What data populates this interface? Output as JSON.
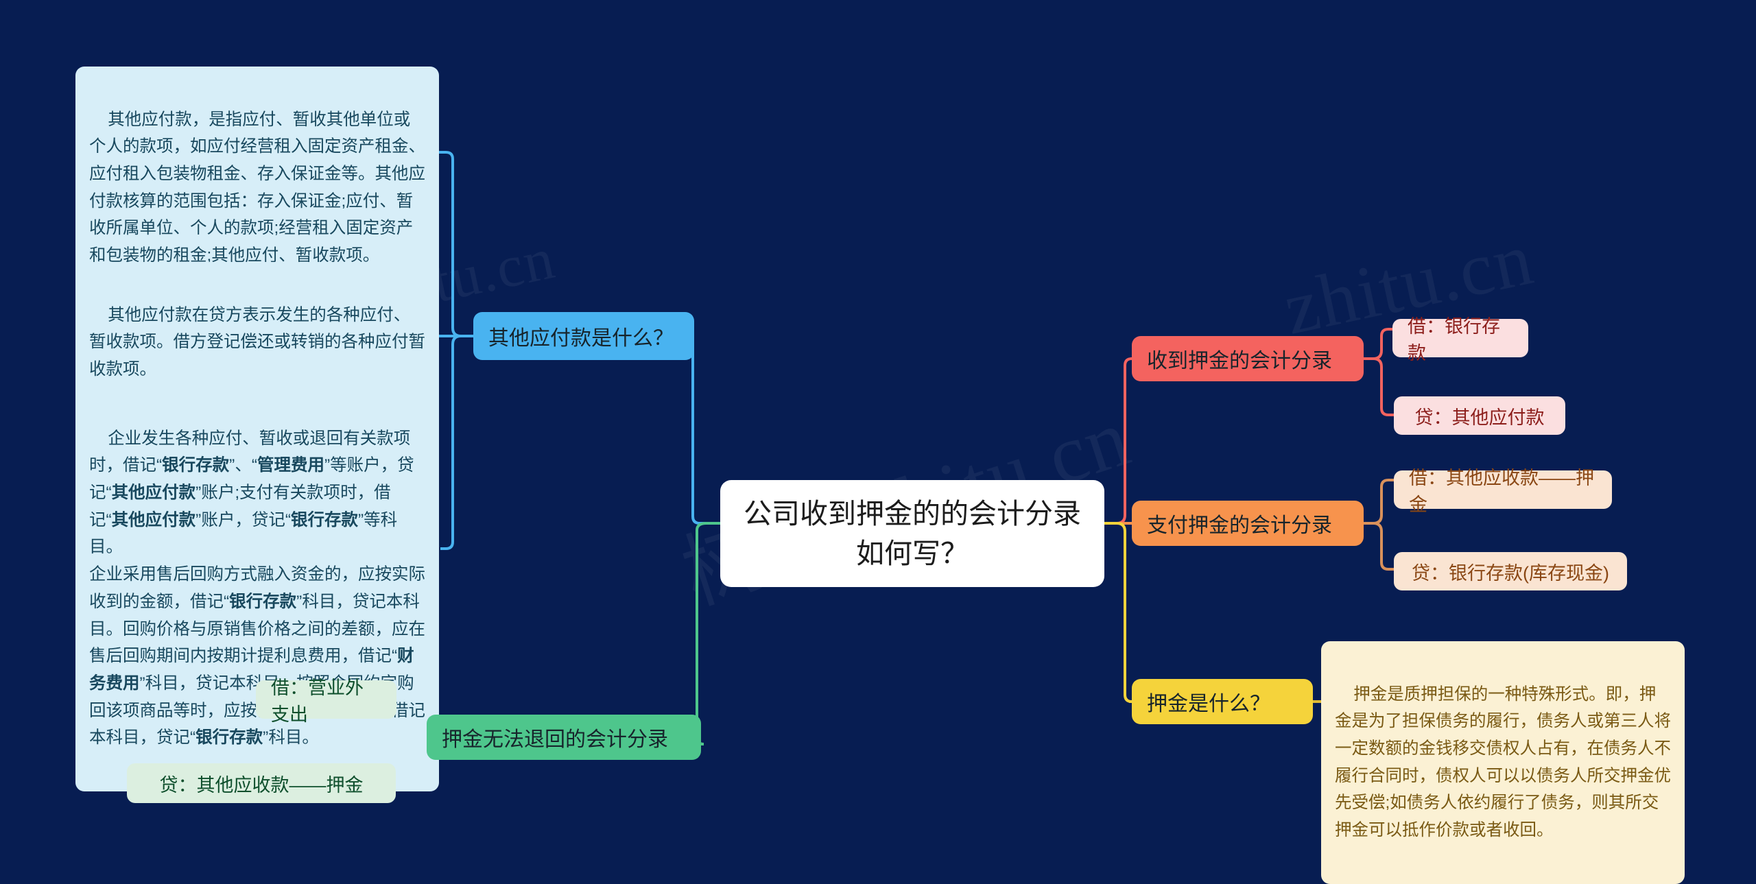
{
  "diagram": {
    "type": "mindmap",
    "background_color": "#071d52",
    "watermarks": [
      "zhitu.cn",
      "zhitu.cn",
      "树图 zhitu.cn"
    ],
    "root": {
      "label": "公司收到押金的的会计分录如何写？",
      "background": "#ffffff",
      "text_color": "#1c1c1c"
    },
    "branches": [
      {
        "id": "other-payables",
        "label": "其他应付款是什么？",
        "color": "#49b3f0",
        "side": "left",
        "children": [
          {
            "id": "op-def",
            "label": "其他应付款，是指应付、暂收其他单位或个人的款项，如应付经营租入固定资产租金、应付租入包装物租金、存入保证金等。其他应付款核算的范围包括：存入保证金;应付、暂收所属单位、个人的款项;经营租入固定资产和包装物的租金;其他应付、暂收款项。",
            "background": "#d7eef8",
            "text_color": "#18485e"
          },
          {
            "id": "op-direction",
            "label": "其他应付款在贷方表示发生的各种应付、暂收款项。借方登记偿还或转销的各种应付暂收款项。",
            "background": "#d7eef8",
            "text_color": "#18485e"
          },
          {
            "id": "op-entries",
            "label_html": "企业发生各种应付、暂收或退回有关款项时，借记“<b>银行存款</b>”、“<b>管理费用</b>”等账户，贷记“<b>其他应付款</b>”账户;支付有关款项时，借记“<b>其他应付款</b>”账户，贷记“<b>银行存款</b>”等科目。\n企业采用售后回购方式融入资金的，应按实际收到的金额，借记“<b>银行存款</b>”科目，贷记本科目。回购价格与原销售价格之间的差额，应在售后回购期间内按期计提利息费用，借记“<b>财务费用</b>”科目，贷记本科目。按照合同约定购回该项商品等时，应按实际支付的金额，借记本科目，贷记“<b>银行存款</b>”科目。",
            "background": "#d7eef8",
            "text_color": "#18485e"
          }
        ]
      },
      {
        "id": "non-refundable",
        "label": "押金无法退回的会计分录",
        "color": "#4ec68c",
        "side": "left",
        "children": [
          {
            "id": "nr-debit",
            "label": "借：营业外支出",
            "background": "#dcefe0",
            "text_color": "#0e4f2c"
          },
          {
            "id": "nr-credit",
            "label": "贷：其他应收款——押金",
            "background": "#dcefe0",
            "text_color": "#0e4f2c"
          }
        ]
      },
      {
        "id": "receive-deposit",
        "label": "收到押金的会计分录",
        "color": "#f4635f",
        "side": "right",
        "children": [
          {
            "id": "rd-debit",
            "label": "借：银行存款",
            "background": "#fbdfe0",
            "text_color": "#8d1f1c"
          },
          {
            "id": "rd-credit",
            "label": "贷：其他应付款",
            "background": "#fbdfe0",
            "text_color": "#8d1f1c"
          }
        ]
      },
      {
        "id": "pay-deposit",
        "label": "支付押金的会计分录",
        "color": "#f7934d",
        "side": "right",
        "children": [
          {
            "id": "pd-debit",
            "label": "借：其他应收款——押金",
            "background": "#fae4d2",
            "text_color": "#8a4714"
          },
          {
            "id": "pd-credit",
            "label": "贷：银行存款(库存现金)",
            "background": "#fae4d2",
            "text_color": "#8a4714"
          }
        ]
      },
      {
        "id": "what-is-deposit",
        "label": "押金是什么？",
        "color": "#f5d33b",
        "side": "right",
        "children": [
          {
            "id": "wd-def",
            "label": "押金是质押担保的一种特殊形式。即，押金是为了担保债务的履行，债务人或第三人将一定数额的金钱移交债权人占有，在债务人不履行合同时，债权人可以以债务人所交押金优先受偿;如债务人依约履行了债务，则其所交押金可以抵作价款或者收回。",
            "background": "#fbf1d4",
            "text_color": "#7a5a14"
          }
        ]
      }
    ]
  }
}
